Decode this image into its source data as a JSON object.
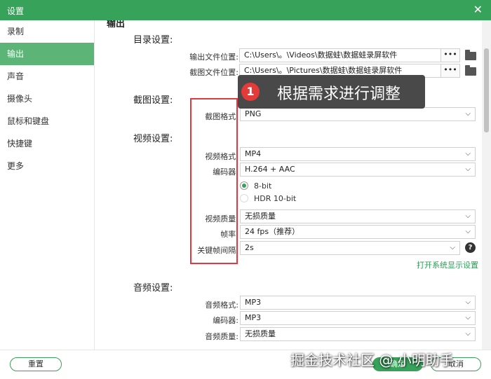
{
  "window": {
    "title": "设置",
    "close_glyph": "✕"
  },
  "sidebar": {
    "items": [
      {
        "label": "录制"
      },
      {
        "label": "输出"
      },
      {
        "label": "声音"
      },
      {
        "label": "摄像头"
      },
      {
        "label": "鼠标和键盘"
      },
      {
        "label": "快捷键"
      },
      {
        "label": "更多"
      }
    ],
    "active_index": 1
  },
  "main": {
    "heading_partial": "输出",
    "dir": {
      "title": "目录设置:",
      "output_label": "输出文件位置:",
      "output_value": "C:\\Users\\。\\Videos\\数据蛙\\数据蛙录屏软件",
      "shot_label": "截图文件位置:",
      "shot_value": "C:\\Users\\。\\Pictures\\数据蛙\\数据蛙录屏软件",
      "dots": "•••"
    },
    "screenshot": {
      "title": "截图设置:",
      "format_label": "截图格式:",
      "format_value": "PNG"
    },
    "video": {
      "title": "视频设置:",
      "format_label": "视频格式:",
      "format_value": "MP4",
      "codec_label": "编码器:",
      "codec_value": "H.264 + AAC",
      "bit8": "8-bit",
      "hdr": "HDR 10-bit",
      "quality_label": "视频质量:",
      "quality_value": "无损质量",
      "fps_label": "帧率:",
      "fps_value": "24 fps（推荐）",
      "keyframe_label": "关键帧间隔:",
      "keyframe_value": "2s",
      "help": "?",
      "display_link": "打开系统显示设置"
    },
    "audio": {
      "title": "音频设置:",
      "format_label": "音频格式:",
      "format_value": "MP3",
      "codec_label": "编码器:",
      "codec_value": "MP3",
      "quality_label": "音频质量:",
      "quality_value": "无损质量"
    }
  },
  "tooltip": {
    "number": "1",
    "text": "根据需求进行调整"
  },
  "footer": {
    "reset": "重置",
    "ok": "确定",
    "cancel": "取消"
  },
  "watermark": "掘金技术社区 @ 小明助手",
  "chevron": "⌵",
  "colors": {
    "accent": "#37a35a",
    "highlight": "#e0393f"
  }
}
